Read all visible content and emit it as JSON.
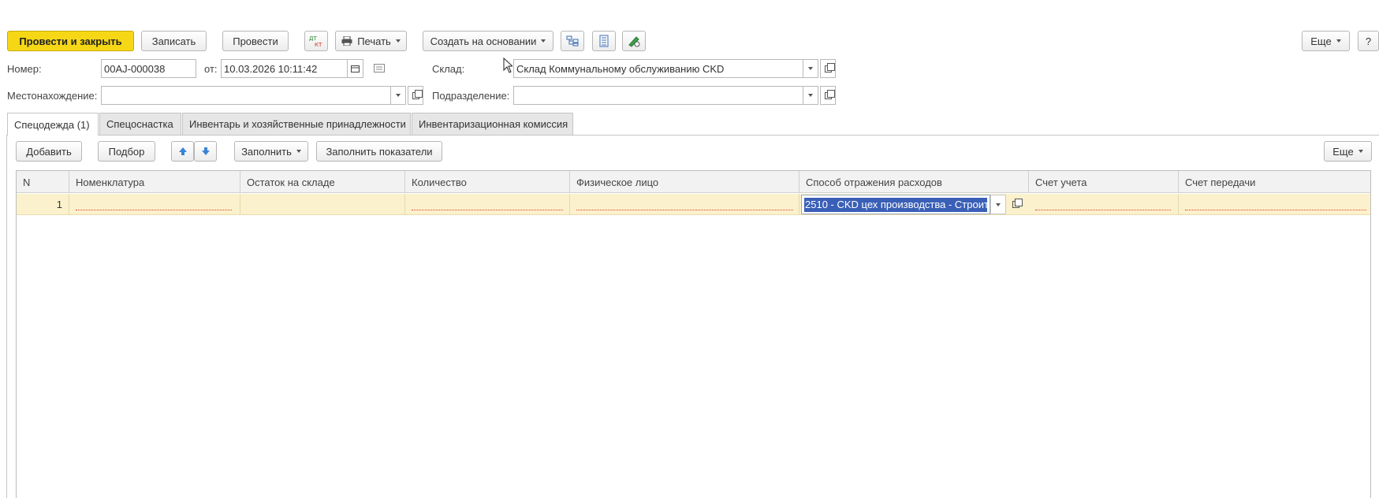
{
  "toolbar": {
    "post_close": "Провести и закрыть",
    "save": "Записать",
    "post": "Провести",
    "dtkt_icon": "dt-kt-icon",
    "print": "Печать",
    "create_based": "Создать на основании",
    "more": "Еще",
    "help": "?"
  },
  "header": {
    "number_label": "Номер:",
    "number_value": "00AJ-000038",
    "date_label": "от:",
    "date_value": "10.03.2026 10:11:42",
    "warehouse_label": "Склад:",
    "warehouse_value": "Склад Коммунальному  обслуживанию  CKD",
    "location_label": "Местонахождение:",
    "location_value": "",
    "division_label": "Подразделение:",
    "division_value": ""
  },
  "tabs": [
    {
      "label": "Спецодежда (1)",
      "active": true
    },
    {
      "label": "Спецоснастка",
      "active": false
    },
    {
      "label": "Инвентарь и хозяйственные принадлежности",
      "active": false
    },
    {
      "label": "Инвентаризационная комиссия",
      "active": false
    }
  ],
  "table_toolbar": {
    "add": "Добавить",
    "pick": "Подбор",
    "fill": "Заполнить",
    "fill_indicators": "Заполнить показатели",
    "more": "Еще"
  },
  "table": {
    "columns": [
      "N",
      "Номенклатура",
      "Остаток на складе",
      "Количество",
      "Физическое лицо",
      "Способ отражения расходов",
      "Счет учета",
      "Счет передачи"
    ],
    "rows": [
      {
        "n": "1",
        "nomenclature": "",
        "stock": "",
        "quantity": "",
        "person": "",
        "expense_method": "2510 - CKD цех производства  - Строит",
        "account": "",
        "transfer_account": ""
      }
    ]
  },
  "colors": {
    "primary_button": "#f5d716",
    "row_highlight": "#fbf1cc",
    "selection": "#3a5fb7"
  }
}
